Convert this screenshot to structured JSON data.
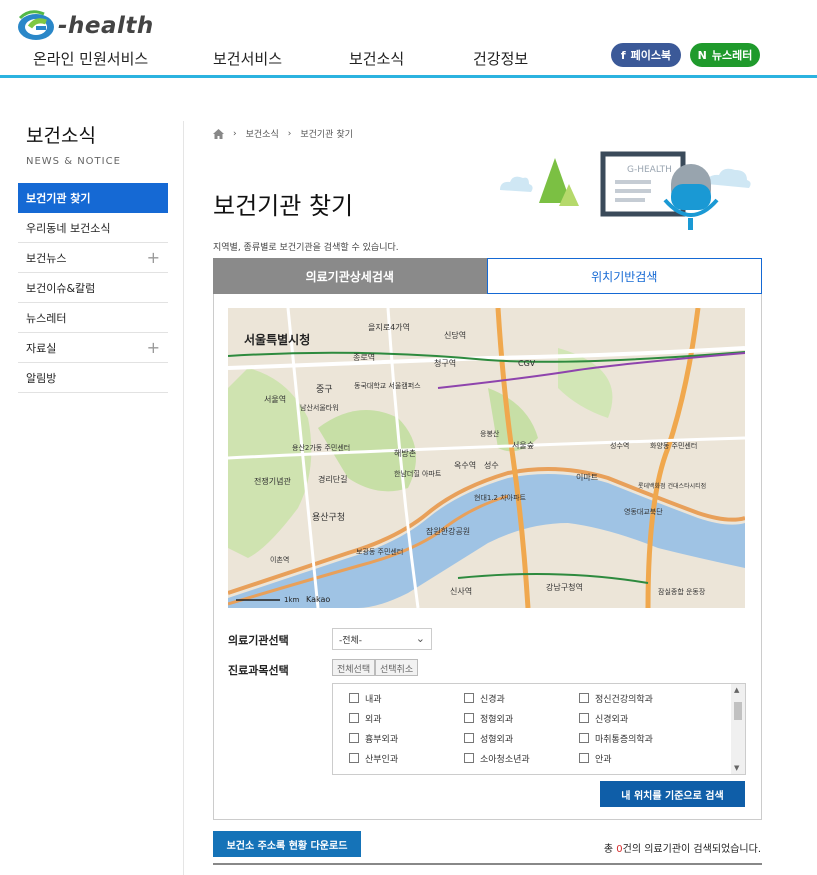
{
  "header": {
    "logo_text": "-health",
    "nav": [
      "온라인 민원서비스",
      "보건서비스",
      "보건소식",
      "건강정보"
    ],
    "sns_facebook": "페이스북",
    "sns_newsletter": "뉴스레터"
  },
  "lnb": {
    "title": "보건소식",
    "subtitle": "NEWS & NOTICE",
    "items": [
      {
        "label": "보건기관 찾기"
      },
      {
        "label": "우리동네 보건소식"
      },
      {
        "label": "보건뉴스"
      },
      {
        "label": "보건이슈&칼럼"
      },
      {
        "label": "뉴스레터"
      },
      {
        "label": "자료실"
      },
      {
        "label": "알림방"
      }
    ]
  },
  "breadcrumb": [
    "보건소식",
    "보건기관 찾기"
  ],
  "page": {
    "title": "보건기관 찾기",
    "description": "지역별, 종류별로 보건기관을 검색할 수 있습니다.",
    "illustration_text": "G-HEALTH"
  },
  "tabs": [
    {
      "label": "의료기관상세검색"
    },
    {
      "label": "위치기반검색"
    }
  ],
  "map": {
    "labels": [
      "서울특별시청",
      "을지로4가역",
      "신당역",
      "청구역",
      "종로역",
      "중구",
      "동국대학교 서울캠퍼스",
      "서울역",
      "남산서울타워",
      "용산2가동 주민센터",
      "해방촌",
      "응봉산",
      "서울숲",
      "성수역",
      "화양동 주민센터",
      "이마트",
      "롯데백화점 건대스타시티점",
      "전쟁기념관",
      "경리단길",
      "한남더힐 아파트",
      "옥수역",
      "성수",
      "현대1.2 차아파트",
      "용산구청",
      "영동대교북단",
      "잠원한강공원",
      "보광동 주민센터",
      "이촌역",
      "강남구청역",
      "신사역",
      "잠실종합 운동장",
      "CGV",
      "1km",
      "Kakao"
    ]
  },
  "form": {
    "facility_label": "의료기관선택",
    "facility_value": "-전체-",
    "department_label": "진료과목선택",
    "select_all": "전체선택",
    "deselect": "선택취소",
    "departments": [
      "내과",
      "신경과",
      "정신건강의학과",
      "외과",
      "정형외과",
      "신경외과",
      "흉부외과",
      "성형외과",
      "마취통증의학과",
      "산부인과",
      "소아청소년과",
      "안과"
    ],
    "search_button": "내 위치를 기준으로 검색"
  },
  "footer": {
    "download_button": "보건소 주소록 현황 다운로드",
    "result_prefix": "총 ",
    "result_count": "0",
    "result_suffix": "건의 의료기관이 검색되었습니다."
  }
}
